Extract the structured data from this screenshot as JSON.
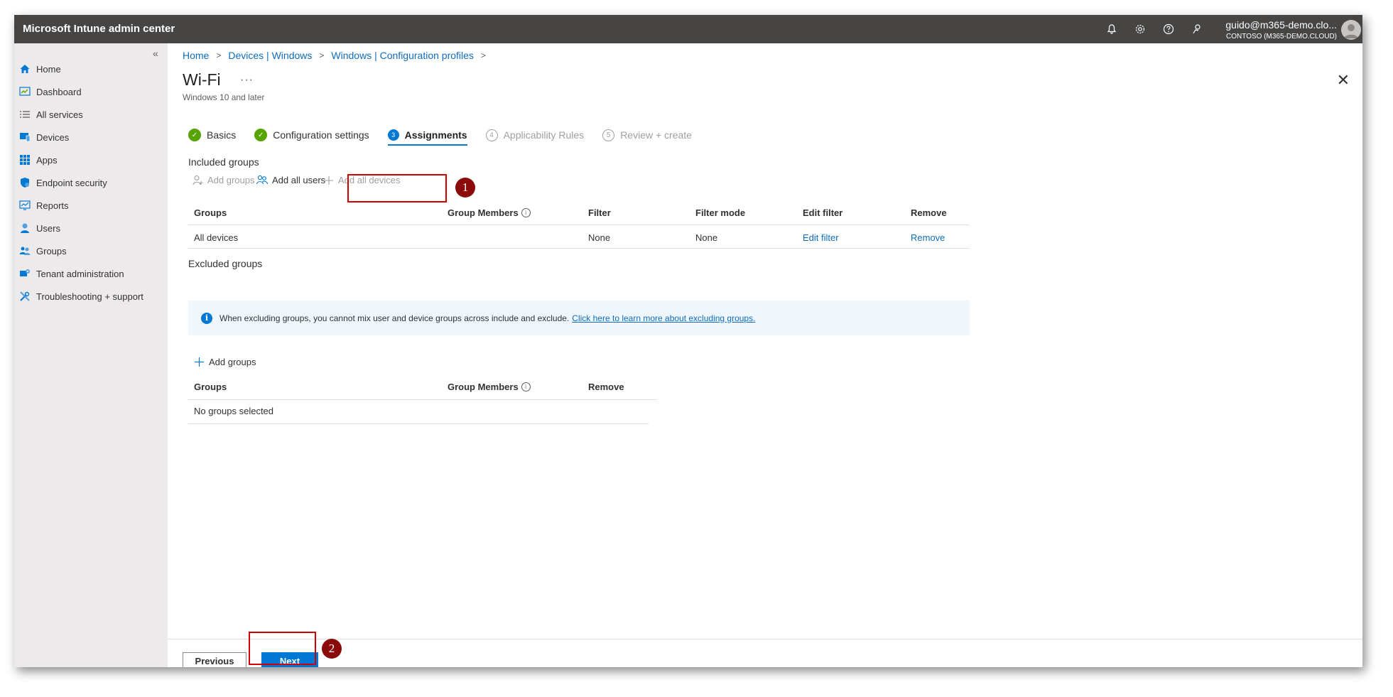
{
  "app": {
    "title": "Microsoft Intune admin center",
    "user_name": "guido@m365-demo.clo...",
    "user_tenant": "CONTOSO (M365-DEMO.CLOUD)"
  },
  "topbar_icons": [
    "bell-icon",
    "gear-icon",
    "help-icon",
    "feedback-icon"
  ],
  "sidebar": {
    "collapse_label": "«",
    "items": [
      {
        "label": "Home",
        "icon": "home-icon"
      },
      {
        "label": "Dashboard",
        "icon": "dashboard-icon"
      },
      {
        "label": "All services",
        "icon": "list-icon"
      },
      {
        "label": "Devices",
        "icon": "devices-icon"
      },
      {
        "label": "Apps",
        "icon": "apps-icon"
      },
      {
        "label": "Endpoint security",
        "icon": "shield-icon"
      },
      {
        "label": "Reports",
        "icon": "reports-icon"
      },
      {
        "label": "Users",
        "icon": "user-icon"
      },
      {
        "label": "Groups",
        "icon": "groups-icon"
      },
      {
        "label": "Tenant administration",
        "icon": "tenant-icon"
      },
      {
        "label": "Troubleshooting + support",
        "icon": "tools-icon"
      }
    ]
  },
  "breadcrumb": [
    "Home",
    "Devices | Windows",
    "Windows | Configuration profiles"
  ],
  "page": {
    "title": "Wi-Fi",
    "ellipsis": "···",
    "subtitle": "Windows 10 and later",
    "close": "✕"
  },
  "steps": [
    {
      "number": "1",
      "label": "Basics",
      "state": "done"
    },
    {
      "number": "2",
      "label": "Configuration settings",
      "state": "done"
    },
    {
      "number": "3",
      "label": "Assignments",
      "state": "active"
    },
    {
      "number": "4",
      "label": "Applicability Rules",
      "state": "todo"
    },
    {
      "number": "5",
      "label": "Review + create",
      "state": "todo"
    }
  ],
  "included": {
    "label": "Included groups",
    "commands": {
      "add_groups": "Add groups",
      "add_all_users": "Add all users",
      "add_all_devices": "Add all devices"
    },
    "headers": {
      "groups": "Groups",
      "members": "Group Members",
      "filter": "Filter",
      "filter_mode": "Filter mode",
      "edit_filter": "Edit filter",
      "remove": "Remove"
    },
    "rows": [
      {
        "group": "All devices",
        "members": "",
        "filter": "None",
        "filter_mode": "None",
        "edit_filter": "Edit filter",
        "remove": "Remove"
      }
    ]
  },
  "excluded": {
    "label": "Excluded groups",
    "info_text": "When excluding groups, you cannot mix user and device groups across include and exclude.",
    "info_link": "Click here to learn more about excluding groups.",
    "add_groups": "Add groups",
    "headers": {
      "groups": "Groups",
      "members": "Group Members",
      "remove": "Remove"
    },
    "empty": "No groups selected"
  },
  "footer": {
    "previous": "Previous",
    "next": "Next"
  },
  "annotations": {
    "marker_1": "1",
    "marker_2": "2",
    "color": "#d10000"
  },
  "colors": {
    "topbar": "#464544",
    "sidebar": "#eceaea",
    "accent": "#0078d4",
    "success": "#57a300",
    "link": "#0f6cbd"
  }
}
